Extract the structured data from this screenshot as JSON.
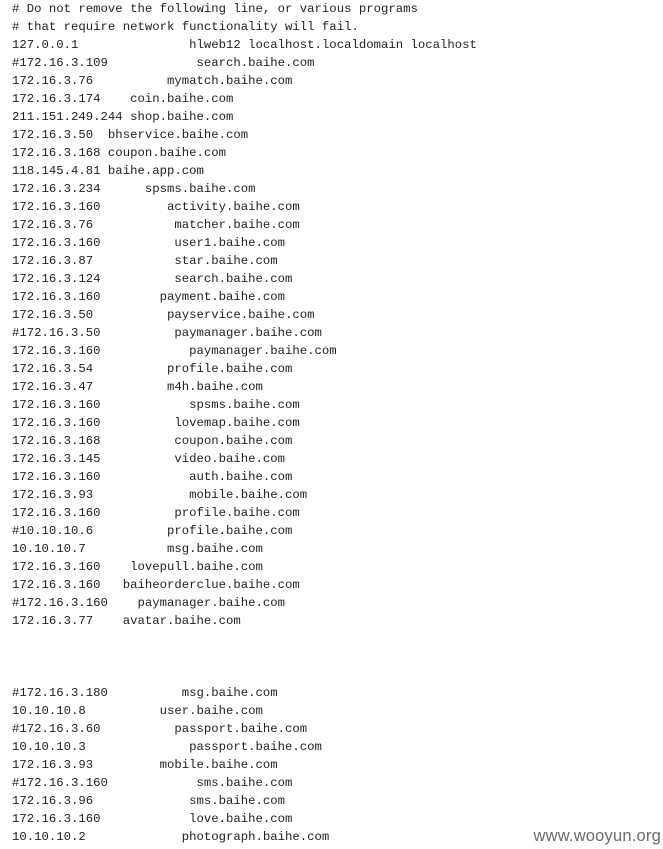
{
  "editor": {
    "lines": [
      "# Do not remove the following line, or various programs",
      "# that require network functionality will fail.",
      "127.0.0.1               hlweb12 localhost.localdomain localhost",
      "#172.16.3.109            search.baihe.com",
      "172.16.3.76          mymatch.baihe.com",
      "172.16.3.174    coin.baihe.com",
      "211.151.249.244 shop.baihe.com",
      "172.16.3.50  bhservice.baihe.com",
      "172.16.3.168 coupon.baihe.com",
      "118.145.4.81 baihe.app.com",
      "172.16.3.234      spsms.baihe.com",
      "172.16.3.160         activity.baihe.com",
      "172.16.3.76           matcher.baihe.com",
      "172.16.3.160          user1.baihe.com",
      "172.16.3.87           star.baihe.com",
      "172.16.3.124          search.baihe.com",
      "172.16.3.160        payment.baihe.com",
      "172.16.3.50          payservice.baihe.com",
      "#172.16.3.50          paymanager.baihe.com",
      "172.16.3.160            paymanager.baihe.com",
      "172.16.3.54          profile.baihe.com",
      "172.16.3.47          m4h.baihe.com",
      "172.16.3.160            spsms.baihe.com",
      "172.16.3.160          lovemap.baihe.com",
      "172.16.3.168          coupon.baihe.com",
      "172.16.3.145          video.baihe.com",
      "172.16.3.160            auth.baihe.com",
      "172.16.3.93             mobile.baihe.com",
      "172.16.3.160          profile.baihe.com",
      "#10.10.10.6          profile.baihe.com",
      "10.10.10.7           msg.baihe.com",
      "172.16.3.160    lovepull.baihe.com",
      "172.16.3.160   baiheorderclue.baihe.com",
      "#172.16.3.160    paymanager.baihe.com",
      "172.16.3.77    avatar.baihe.com",
      "",
      "",
      "",
      "#172.16.3.180          msg.baihe.com",
      "10.10.10.8          user.baihe.com",
      "#172.16.3.60          passport.baihe.com",
      "10.10.10.3              passport.baihe.com",
      "172.16.3.93         mobile.baihe.com",
      "#172.16.3.160            sms.baihe.com",
      "172.16.3.96             sms.baihe.com",
      "172.16.3.160            love.baihe.com",
      "10.10.10.2             photograph.baihe.com"
    ]
  },
  "watermark": "www.wooyun.org"
}
